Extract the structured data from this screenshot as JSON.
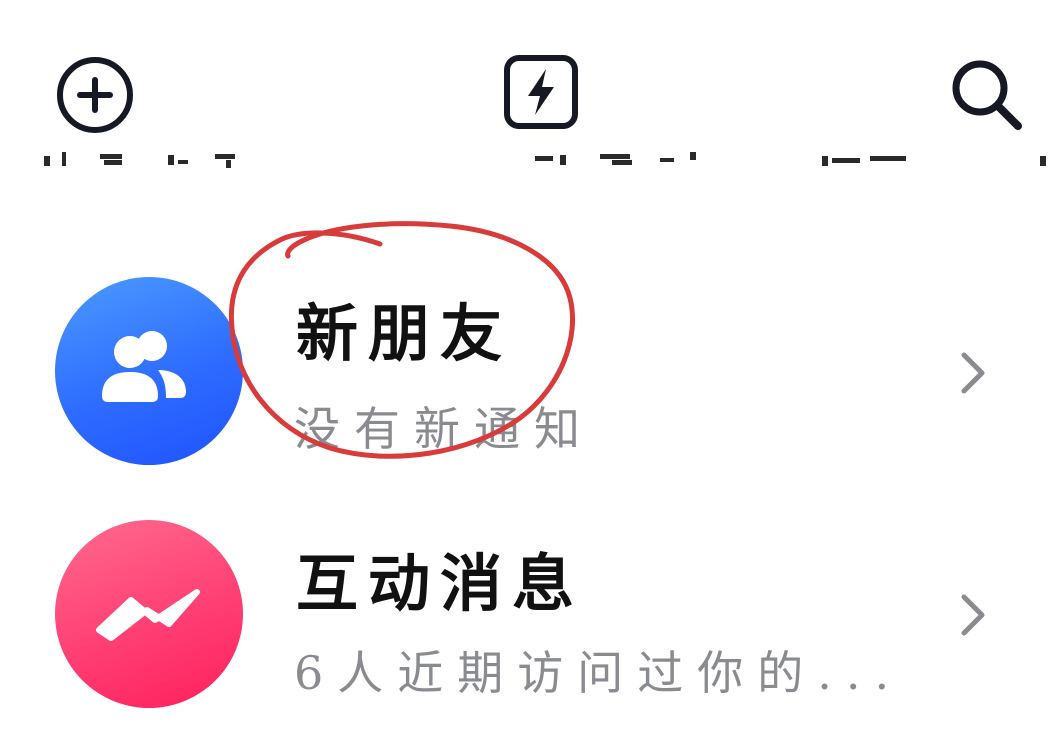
{
  "topbar": {
    "icons": [
      "add-circle-icon",
      "flash-icon",
      "search-icon"
    ]
  },
  "list": {
    "items": [
      {
        "title": "新朋友",
        "subtitle": "没有新通知",
        "icon": "friends-icon",
        "avatar_color": "#2e6cff"
      },
      {
        "title": "互动消息",
        "subtitle": "6人近期访问过你的...",
        "icon": "message-icon",
        "avatar_color": "#ff3f74"
      }
    ]
  },
  "colors": {
    "annotation": "#d93b3b",
    "text_primary": "#111111",
    "text_secondary": "#8a8b91",
    "chevron": "#8a8b91"
  }
}
